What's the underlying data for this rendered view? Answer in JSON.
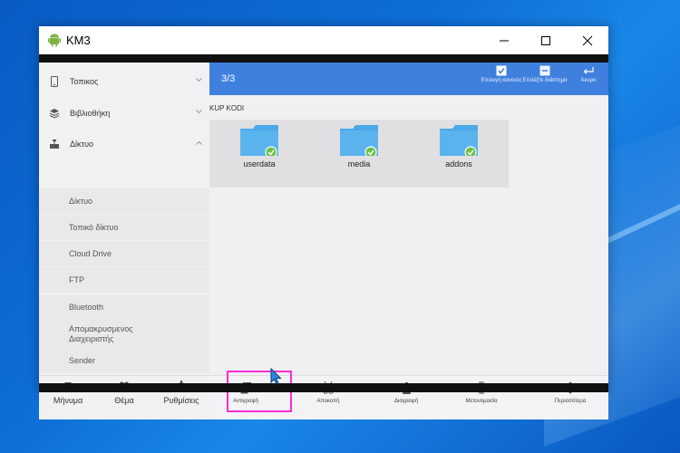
{
  "window": {
    "title": "KM3"
  },
  "sidebar": {
    "items": [
      {
        "label": "Τοπικος",
        "icon": "phone-icon"
      },
      {
        "label": "Βιβλιοθήκη",
        "icon": "library-icon"
      },
      {
        "label": "Δίκτυο",
        "icon": "network-icon"
      }
    ],
    "sub_items": [
      "Δίκτυο",
      "Τοπικό δίκτυο",
      "Cloud Drive",
      "FTP",
      "Bluetooth",
      "Απομακρυσμενος Διαχειριστής",
      "Sender"
    ],
    "bottom": [
      {
        "label": "Μήνυμα",
        "icon": "mail-icon"
      },
      {
        "label": "Θέμα",
        "icon": "shirt-icon"
      },
      {
        "label": "Ρυθμίσεις",
        "icon": "gear-icon"
      }
    ]
  },
  "toolbar": {
    "count": "3/3",
    "select_none": "Επιλογή κανενός",
    "select_range": "Επιλέξτε διάστημα",
    "cancel": "Άκυρο"
  },
  "path": "KUP KODI",
  "folders": [
    "userdata",
    "media",
    "addons"
  ],
  "bottom_actions": [
    {
      "label": "Αντιγραφή",
      "icon": "copy-icon"
    },
    {
      "label": "Αποκοπή",
      "icon": "scissors-icon"
    },
    {
      "label": "Διαγραφή",
      "icon": "trash-icon"
    },
    {
      "label": "Μετονομασία",
      "icon": "rename-icon"
    },
    {
      "label": "Περισσότερα",
      "icon": "more-icon"
    }
  ],
  "colors": {
    "accent": "#3f7fde",
    "highlight": "#ff2bd6",
    "check": "#6cc04a",
    "folder": "#4aa8e8"
  }
}
